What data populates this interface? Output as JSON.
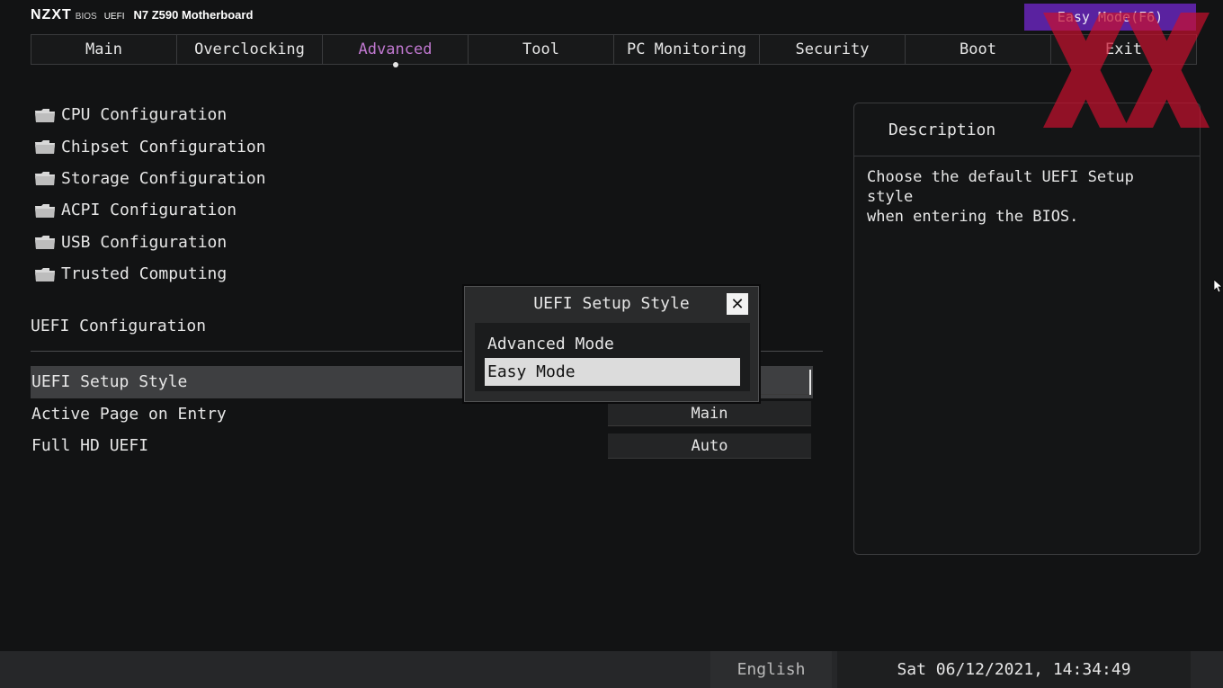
{
  "header": {
    "brand_logo": "NZXT",
    "brand_bios": "BIOS",
    "brand_uefi": "UEFI",
    "model": "N7 Z590 Motherboard",
    "easy_mode_button": "Easy Mode(F6)"
  },
  "tabs": [
    {
      "label": "Main",
      "active": false
    },
    {
      "label": "Overclocking",
      "active": false
    },
    {
      "label": "Advanced",
      "active": true
    },
    {
      "label": "Tool",
      "active": false
    },
    {
      "label": "PC Monitoring",
      "active": false
    },
    {
      "label": "Security",
      "active": false
    },
    {
      "label": "Boot",
      "active": false
    },
    {
      "label": "Exit",
      "active": false
    }
  ],
  "menu": [
    {
      "label": "CPU Configuration",
      "icon": "folder-icon"
    },
    {
      "label": "Chipset Configuration",
      "icon": "folder-icon"
    },
    {
      "label": "Storage Configuration",
      "icon": "folder-icon"
    },
    {
      "label": "ACPI Configuration",
      "icon": "folder-icon"
    },
    {
      "label": "USB Configuration",
      "icon": "folder-icon"
    },
    {
      "label": "Trusted Computing",
      "icon": "folder-icon"
    }
  ],
  "section": {
    "title": "UEFI Configuration"
  },
  "settings": [
    {
      "label": "UEFI Setup Style",
      "value": "",
      "selected": true
    },
    {
      "label": "Active Page on Entry",
      "value": "Main",
      "selected": false
    },
    {
      "label": "Full HD UEFI",
      "value": "Auto",
      "selected": false
    }
  ],
  "description": {
    "title": "Description",
    "text": "Choose the default UEFI Setup style\nwhen entering the BIOS."
  },
  "dialog": {
    "title": "UEFI Setup Style",
    "options": [
      "Advanced Mode",
      "Easy Mode"
    ],
    "selected": "Easy Mode"
  },
  "footer": {
    "language": "English",
    "datetime": "Sat 06/12/2021, 14:34:49"
  },
  "colors": {
    "accent_purple": "#5a22a0",
    "active_tab": "#c078d0",
    "background": "#121314",
    "watermark_red": "#c8102e"
  }
}
